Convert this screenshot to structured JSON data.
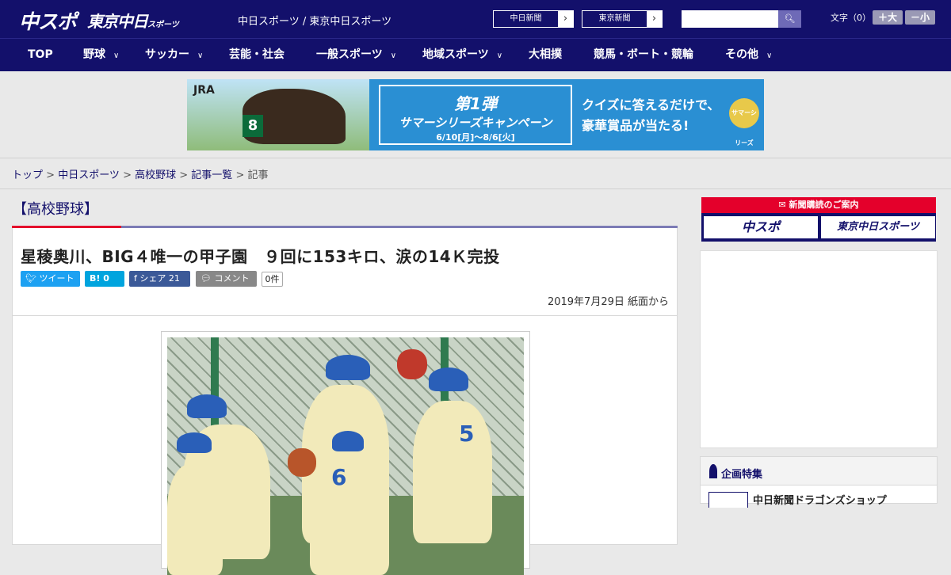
{
  "header": {
    "logo_main": "中スポ",
    "logo_sub": "東京中日",
    "logo_sub_small": "スポーツ",
    "site_links": "中日スポーツ / 東京中日スポーツ",
    "paper_buttons": [
      "中日新聞",
      "東京新聞"
    ],
    "font_label": "文字（0）",
    "font_bigger": "＋大",
    "font_smaller": "－小"
  },
  "nav": {
    "items": [
      {
        "label": "TOP",
        "dropdown": false
      },
      {
        "label": "野球",
        "dropdown": true
      },
      {
        "label": "サッカー",
        "dropdown": true
      },
      {
        "label": "芸能・社会",
        "dropdown": false
      },
      {
        "label": "一般スポーツ",
        "dropdown": true
      },
      {
        "label": "地域スポーツ",
        "dropdown": true
      },
      {
        "label": "大相撲",
        "dropdown": false
      },
      {
        "label": "競馬・ボート・競輪",
        "dropdown": false
      },
      {
        "label": "その他",
        "dropdown": true
      }
    ]
  },
  "banner": {
    "brand": "JRA",
    "horse_number": "8",
    "headline_1": "第1弾",
    "headline_2": "サマーシリーズキャンペーン",
    "dates": "6/10[月]～8/6[火]",
    "copy_1": "クイズに答えるだけで、",
    "copy_2": "豪華賞品が当たる!",
    "badge": "サマーシリーズ"
  },
  "breadcrumb": {
    "links": [
      "トップ",
      "中日スポーツ",
      "高校野球",
      "記事一覧"
    ],
    "current": "記事",
    "sep": " > "
  },
  "category": "【高校野球】",
  "article": {
    "title": "星稜奥川、BIG４唯一の甲子園　９回に153キロ、涙の14Ｋ完投",
    "share": {
      "tweet": "ツイート",
      "hatena": "B! 0",
      "facebook": "シェア 21",
      "comment": "コメント",
      "comment_count": "0件"
    },
    "date": "2019年7月29日 紙面から"
  },
  "sidebar": {
    "subscribe_bar": "新聞購読のご案内",
    "subscribe_1": "中スポ",
    "subscribe_2": "東京中日スポーツ",
    "feature_heading": "企画特集",
    "feature_item": "中日新聞ドラゴンズショップ"
  },
  "colors": {
    "brand_navy": "#13106b",
    "accent_red": "#e4002b",
    "twitter": "#1da1f2",
    "hatena": "#00a4de",
    "facebook": "#3b5998",
    "comment": "#888888"
  }
}
